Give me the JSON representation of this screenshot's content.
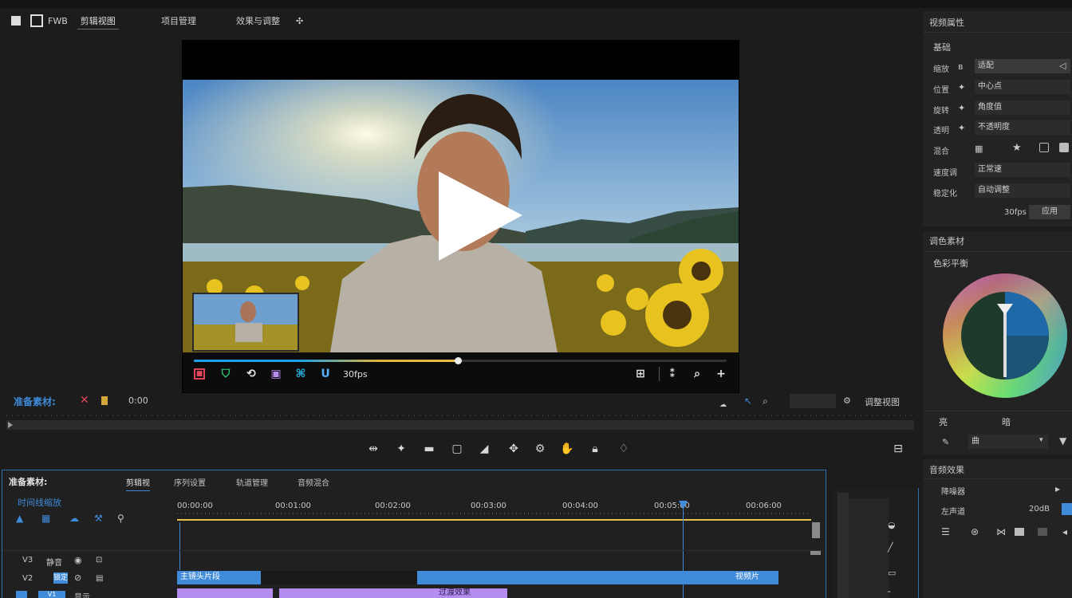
{
  "menu": {
    "item1": "FWB",
    "item2": "剪辑视图",
    "item3": "项目管理",
    "item4": "效果与调整"
  },
  "preview": {
    "toolbar_time": "30fps"
  },
  "prep": {
    "label": "准备素材:",
    "value": "0:00",
    "right_label": "调整视图"
  },
  "inspector": {
    "title": "视频属性",
    "section": "基础",
    "rows": [
      {
        "label": "缩放",
        "value": "适配"
      },
      {
        "label": "位置",
        "value": "中心点"
      },
      {
        "label": "旋转",
        "value": "角度值"
      },
      {
        "label": "透明",
        "value": "不透明度"
      }
    ],
    "row5_label": "混合",
    "row6_label": "速度调",
    "row6_value": "正常速",
    "row7_label": "稳定化",
    "row7_value": "自动调整",
    "row8_value": "30fps",
    "row8_btn": "应用"
  },
  "color": {
    "panel_title": "调色素材",
    "wheel_title": "色彩平衡",
    "btn_left": "亮",
    "btn_right": "暗",
    "select_value": "曲"
  },
  "lower_right": {
    "title": "音频效果",
    "row1": "降噪器",
    "row2_left": "左声道",
    "row2_right": "20dB"
  },
  "timeline": {
    "title": "准备素材:",
    "tabs": [
      "剪辑视",
      "序列设置",
      "轨道管理",
      "音频混合"
    ],
    "sub_label": "时间线缩放",
    "times": [
      "00:00:00",
      "00:01:00",
      "00:02:00",
      "00:03:00",
      "00:04:00",
      "00:05:00",
      "00:06:00"
    ],
    "track1": "V3",
    "track1_val": "静音",
    "track2": "V2",
    "track2_val": "锁定",
    "track3": "V1",
    "track3_val": "显示",
    "clip1": "主镜头片段",
    "clip2": "视频片",
    "clip3": "过渡效果"
  },
  "colors": {
    "accent": "#3f8ad9",
    "panel": "#232323",
    "background": "#1c1c1c"
  }
}
